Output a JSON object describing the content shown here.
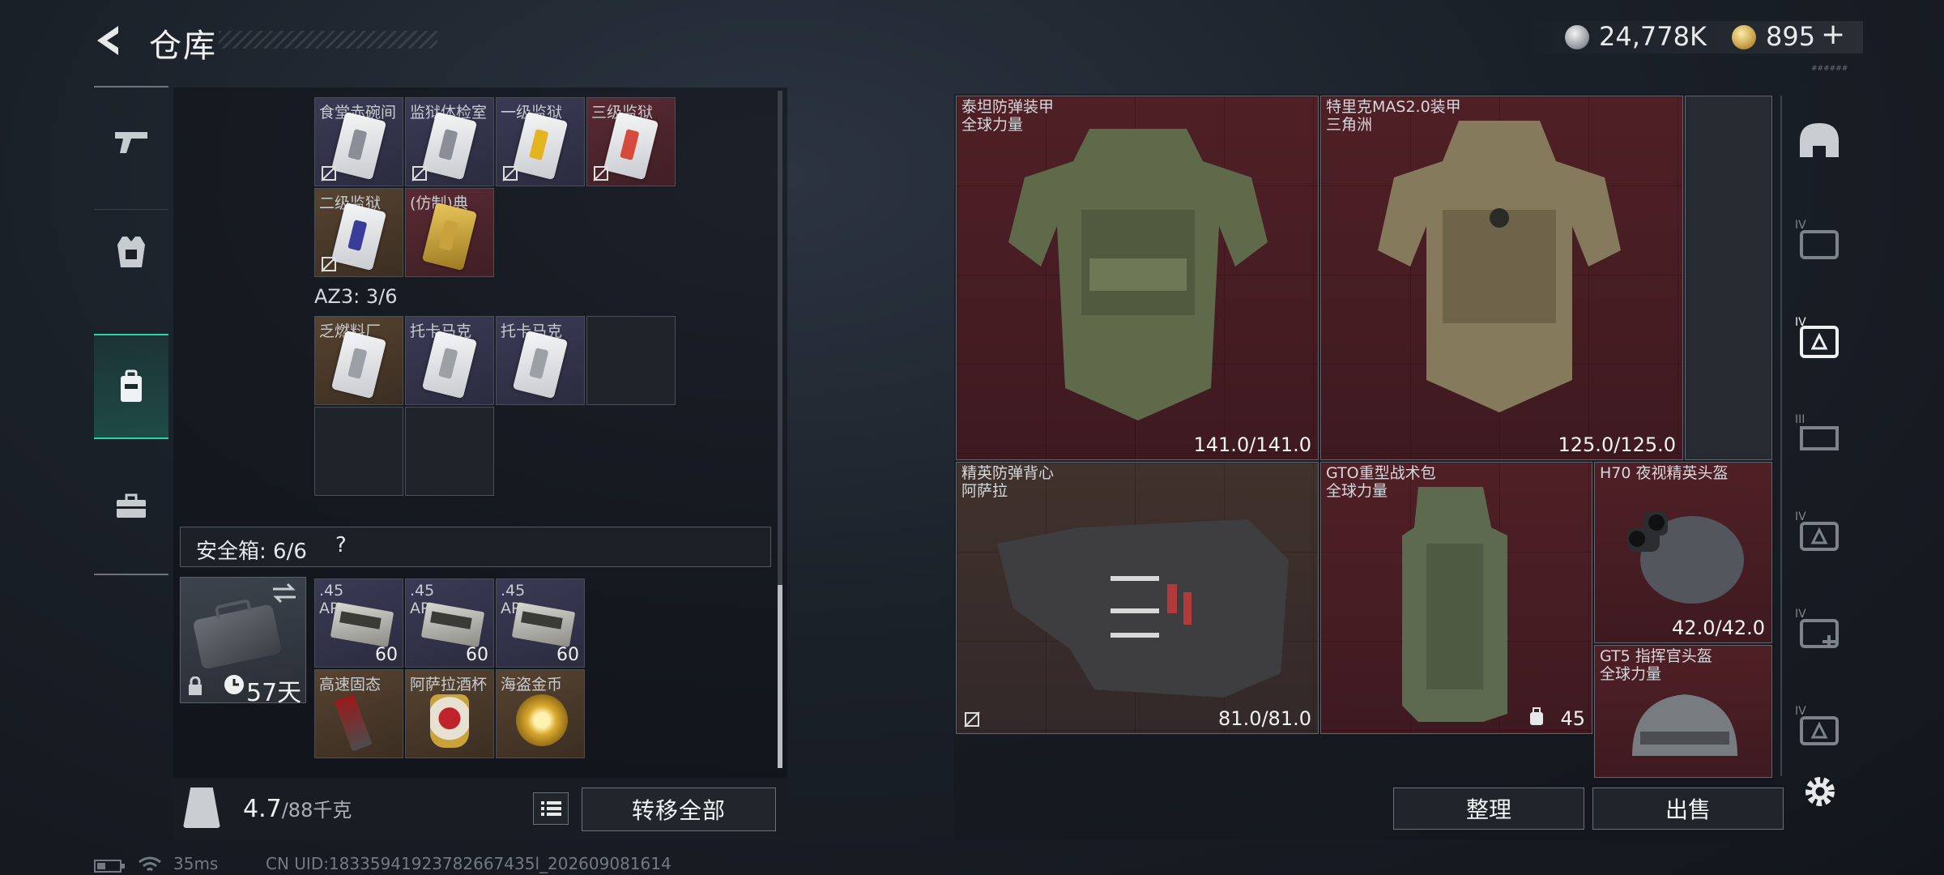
{
  "header": {
    "title": "仓库",
    "currency_silver": "24,778K",
    "currency_gold": "895",
    "gold_plus": "+"
  },
  "left_nav": [
    "weapons",
    "gear",
    "backpack",
    "case"
  ],
  "stash_grid": {
    "row1": [
      {
        "name": "食堂赤碗间",
        "color": "purple",
        "stripe": "#8a8f97"
      },
      {
        "name": "监狱体检室",
        "color": "purple",
        "stripe": "#8a8f97"
      },
      {
        "name": "一级监狱",
        "color": "purple",
        "stripe": "#e3b321"
      },
      {
        "name": "三级监狱",
        "color": "red",
        "stripe": "#d64a3c"
      }
    ],
    "row2": [
      {
        "name": "二级监狱",
        "color": "orange",
        "stripe": "#3b3b9a"
      },
      {
        "name": "(仿制)典",
        "color": "red",
        "stripe": "#c8a23c"
      }
    ]
  },
  "az3": {
    "label": "AZ3: 3/6",
    "items": [
      {
        "name": "乏燃料厂",
        "color": "orange"
      },
      {
        "name": "托卡马克",
        "color": "purple"
      },
      {
        "name": "托卡马克",
        "color": "purple"
      }
    ]
  },
  "safe_box": {
    "label": "安全箱: 6/6",
    "help": "?",
    "days": "57天",
    "ammo": [
      {
        "name": ".45\nAP",
        "count": "60"
      },
      {
        "name": ".45\nAP",
        "count": "60"
      },
      {
        "name": ".45\nAP",
        "count": "60"
      }
    ],
    "valuables": [
      {
        "name": "高速固态"
      },
      {
        "name": "阿萨拉酒杯"
      },
      {
        "name": "海盗金币"
      }
    ]
  },
  "weight": {
    "value": "4.7",
    "capacity": "/88千克"
  },
  "buttons": {
    "transfer_all": "转移全部",
    "sort": "整理",
    "sell": "出售"
  },
  "equipment": [
    {
      "name": "泰坦防弹装甲\n全球力量",
      "durability": "141.0/141.0"
    },
    {
      "name": "特里克MAS2.0装甲\n三角洲",
      "durability": "125.0/125.0"
    },
    {
      "name": "精英防弹背心\n阿萨拉",
      "durability": "81.0/81.0"
    },
    {
      "name": "GTO重型战术包\n全球力量",
      "capacity": "45"
    },
    {
      "name": "H70 夜视精英头盔",
      "durability": "42.0/42.0"
    },
    {
      "name": "GT5 指挥官头盔\n全球力量"
    }
  ],
  "status": {
    "ping": "35ms",
    "uid": "CN UID:18335941923782667435l_202609081614"
  },
  "version": "######"
}
